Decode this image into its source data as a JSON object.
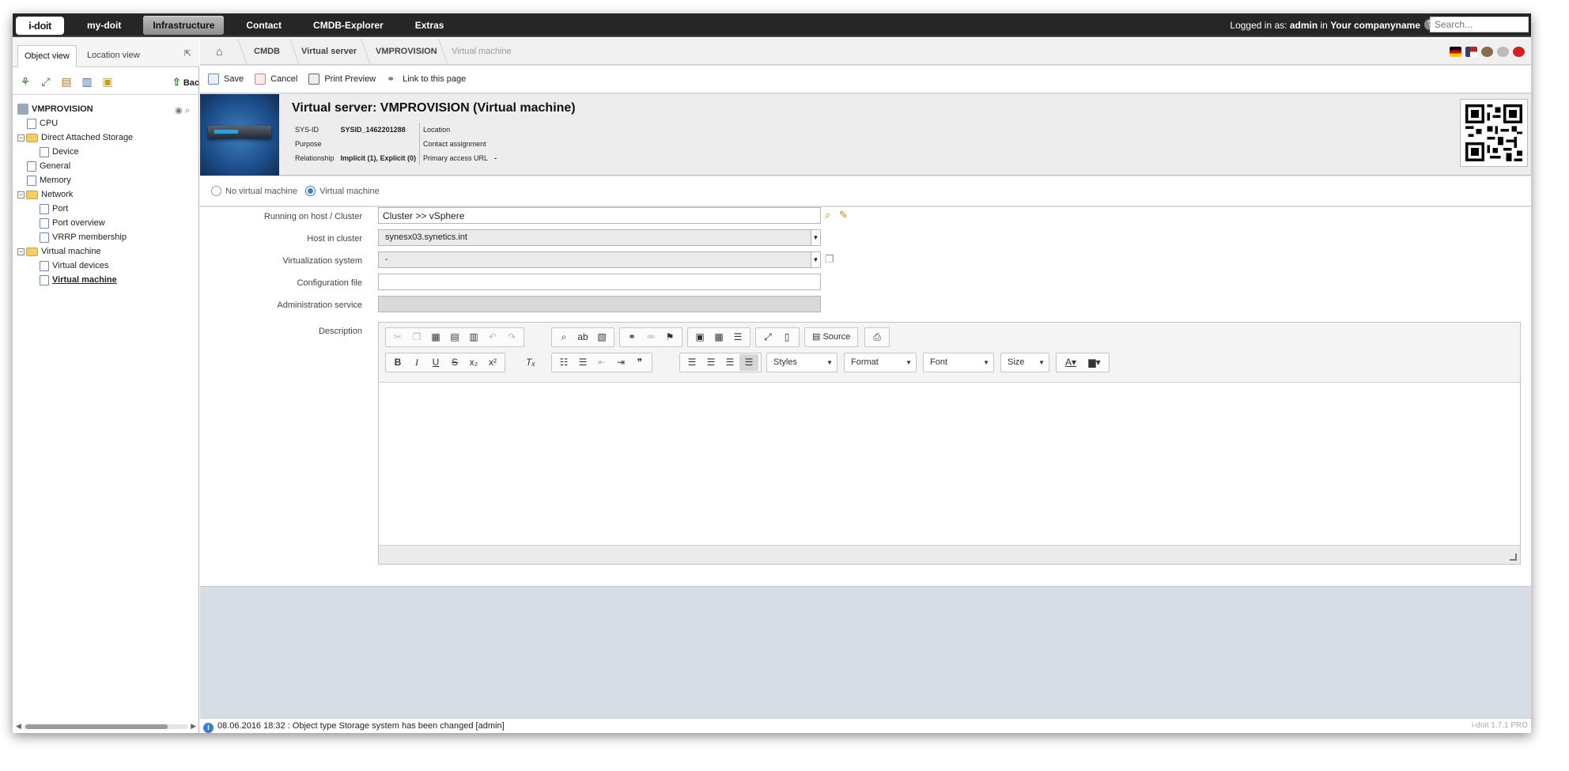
{
  "app": {
    "logo_text": "i-doit"
  },
  "topnav": {
    "items": [
      "my-doit",
      "Infrastructure",
      "Contact",
      "CMDB-Explorer",
      "Extras"
    ],
    "active": "Infrastructure",
    "login_prefix": "Logged in as:",
    "user": "admin",
    "login_in": "in",
    "company": "Your companyname",
    "search_placeholder": "Search..."
  },
  "left": {
    "tab_object": "Object view",
    "tab_location": "Location view",
    "back_label": "Bac",
    "tree": {
      "root": "VMPROVISION",
      "items": [
        {
          "label": "CPU",
          "level": 1,
          "type": "page"
        },
        {
          "label": "Direct Attached Storage",
          "level": 1,
          "type": "folder"
        },
        {
          "label": "Device",
          "level": 2,
          "type": "page"
        },
        {
          "label": "General",
          "level": 1,
          "type": "page"
        },
        {
          "label": "Memory",
          "level": 1,
          "type": "page"
        },
        {
          "label": "Network",
          "level": 1,
          "type": "folder"
        },
        {
          "label": "Port",
          "level": 2,
          "type": "page"
        },
        {
          "label": "Port overview",
          "level": 2,
          "type": "page"
        },
        {
          "label": "VRRP membership",
          "level": 2,
          "type": "page"
        },
        {
          "label": "Virtual machine",
          "level": 1,
          "type": "folder"
        },
        {
          "label": "Virtual devices",
          "level": 2,
          "type": "page"
        },
        {
          "label": "Virtual machine",
          "level": 2,
          "type": "page",
          "selected": true
        }
      ]
    }
  },
  "breadcrumb": [
    "CMDB",
    "Virtual server",
    "VMPROVISION",
    "Virtual machine"
  ],
  "toolbar": {
    "save": "Save",
    "cancel": "Cancel",
    "print": "Print Preview",
    "link": "Link to this page"
  },
  "object": {
    "title": "Virtual server: VMPROVISION (Virtual machine)",
    "sysid_label": "SYS-ID",
    "sysid": "SYSID_1462201288",
    "purpose_label": "Purpose",
    "purpose": "",
    "relationship_label": "Relationship",
    "relationship": "Implicit (1), Explicit (0)",
    "location_label": "Location",
    "contact_label": "Contact assignment",
    "access_label": "Primary access URL",
    "access": "-"
  },
  "vm": {
    "no_vm": "No virtual machine",
    "vm": "Virtual machine",
    "selected": "vm"
  },
  "form": {
    "host_label": "Running on host / Cluster",
    "host_value": "Cluster >> vSphere",
    "cluster_label": "Host in cluster",
    "cluster_value": "synesx03.synetics.int",
    "virt_label": "Virtualization system",
    "virt_value": "-",
    "config_label": "Configuration file",
    "config_value": "",
    "admin_label": "Administration service",
    "desc_label": "Description"
  },
  "editor": {
    "source": "Source",
    "styles": "Styles",
    "format": "Format",
    "font": "Font",
    "size": "Size"
  },
  "status": {
    "message": "08.06.2016 18:32 : Object type Storage system has been changed [admin]",
    "version": "i-doit 1.7.1 PRO"
  }
}
